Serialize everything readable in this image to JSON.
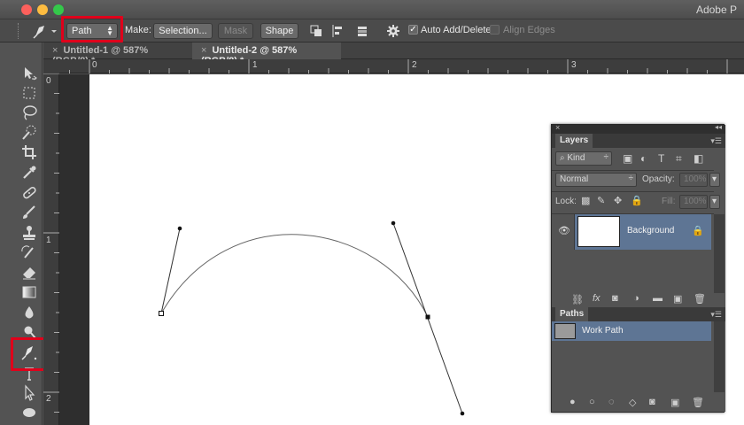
{
  "app": {
    "title": "Adobe P"
  },
  "options": {
    "tool_mode": "Path",
    "make_label": "Make:",
    "selection_btn": "Selection...",
    "mask_btn": "Mask",
    "shape_btn": "Shape",
    "auto_add_delete_label": "Auto Add/Delete",
    "auto_add_delete_checked": true,
    "align_edges_label": "Align Edges",
    "align_edges_checked": false
  },
  "tabs": [
    {
      "label": "Untitled-1 @ 587% (RGB/8) *",
      "active": false
    },
    {
      "label": "Untitled-2 @ 587% (RGB/8) *",
      "active": true
    }
  ],
  "rulers": {
    "top_labels": [
      "0",
      "1",
      "2",
      "3"
    ],
    "left_labels": [
      "0",
      "1",
      "2"
    ]
  },
  "layers_panel": {
    "title": "Layers",
    "filter_label": "Kind",
    "blend_mode": "Normal",
    "opacity_label": "Opacity:",
    "opacity_value": "100%",
    "lock_label": "Lock:",
    "fill_label": "Fill:",
    "fill_value": "100%",
    "layers": [
      {
        "name": "Background",
        "locked": true,
        "visible": true
      }
    ]
  },
  "paths_panel": {
    "title": "Paths",
    "paths": [
      {
        "name": "Work Path"
      }
    ]
  },
  "highlight_color": "#e0001b"
}
